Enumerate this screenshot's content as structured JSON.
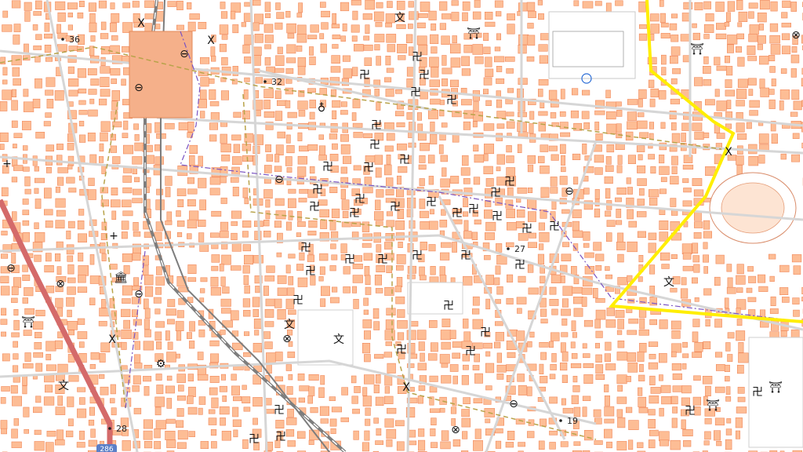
{
  "map": {
    "colors": {
      "block": "#fdbd95",
      "block_stroke": "#f0885a",
      "road_edge": "#d9d9d9",
      "prefecture_border": "#ffee00",
      "railway": "#8a8a8a",
      "national_route": "#d46a6a",
      "admin_boundary": "#b8a34a",
      "district_boundary": "#7a54c2",
      "symbol": "#111111"
    },
    "elevation_points": [
      {
        "label": "36"
      },
      {
        "label": "32"
      },
      {
        "label": "27"
      },
      {
        "label": "19"
      },
      {
        "label": "28"
      }
    ],
    "route_shield": {
      "label": "286"
    },
    "symbols": {
      "temple": "卍",
      "shrine": "⛩",
      "school": "文",
      "police_box": "X",
      "post_office": "⊗",
      "hospital": "+",
      "museum": "🏛",
      "government_office": "⊖",
      "factory": "⚙",
      "monument": "♁"
    }
  }
}
